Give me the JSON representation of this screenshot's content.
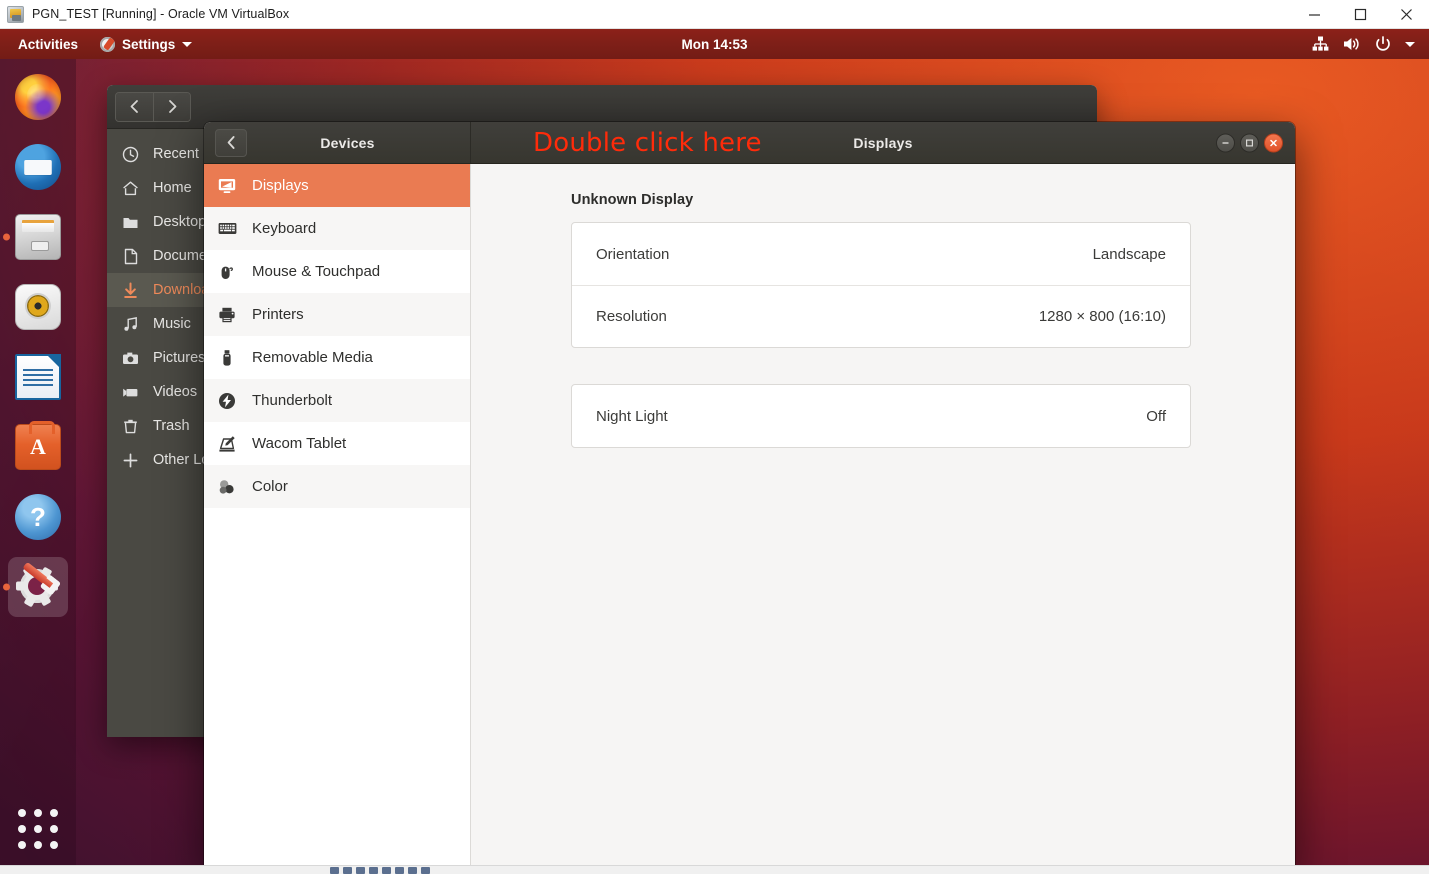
{
  "host": {
    "title": "PGN_TEST [Running] - Oracle VM VirtualBox",
    "icon": "virtualbox-icon",
    "window_controls": [
      {
        "name": "minimize",
        "glyph": "minimize-icon"
      },
      {
        "name": "maximize",
        "glyph": "maximize-icon"
      },
      {
        "name": "close",
        "glyph": "close-icon"
      }
    ]
  },
  "topbar": {
    "activities": "Activities",
    "app_menu": "Settings",
    "app_icon": "settings-app-icon",
    "clock": "Mon 14:53",
    "indicators": [
      {
        "name": "network-icon"
      },
      {
        "name": "volume-icon"
      },
      {
        "name": "power-icon"
      },
      {
        "name": "chevron-down-icon"
      }
    ]
  },
  "dock": {
    "items": [
      {
        "name": "firefox",
        "label": "Firefox",
        "icon": "firefox-icon",
        "active": false
      },
      {
        "name": "thunderbird",
        "label": "Thunderbird",
        "icon": "thunderbird-icon",
        "active": false
      },
      {
        "name": "files",
        "label": "Files",
        "icon": "files-icon",
        "active": true
      },
      {
        "name": "rhythmbox",
        "label": "Rhythmbox",
        "icon": "rhythmbox-icon",
        "active": false
      },
      {
        "name": "libreoffice",
        "label": "LibreOffice Writer",
        "icon": "libreoffice-icon",
        "active": false
      },
      {
        "name": "ubuntu-software",
        "label": "Ubuntu Software",
        "icon": "ubuntu-software-icon",
        "active": false
      },
      {
        "name": "help",
        "label": "Help",
        "icon": "help-icon",
        "active": false
      },
      {
        "name": "settings",
        "label": "Settings",
        "icon": "settings-icon",
        "active": true
      }
    ],
    "show_applications": "Show Applications"
  },
  "files_window": {
    "nav": {
      "back": "Back",
      "forward": "Forward"
    },
    "places": [
      {
        "label": "Recent",
        "icon": "clock-icon",
        "selected": false
      },
      {
        "label": "Home",
        "icon": "home-icon",
        "selected": false
      },
      {
        "label": "Desktop",
        "icon": "folder-icon",
        "selected": false
      },
      {
        "label": "Documents",
        "icon": "document-icon",
        "selected": false
      },
      {
        "label": "Downloads",
        "icon": "download-icon",
        "selected": true
      },
      {
        "label": "Music",
        "icon": "music-icon",
        "selected": false
      },
      {
        "label": "Pictures",
        "icon": "camera-icon",
        "selected": false
      },
      {
        "label": "Videos",
        "icon": "video-icon",
        "selected": false
      },
      {
        "label": "Trash",
        "icon": "trash-icon",
        "selected": false
      },
      {
        "label": "Other Locations",
        "icon": "plus-icon",
        "selected": false
      }
    ]
  },
  "settings_window": {
    "sidebar_title": "Devices",
    "back_button": "Back",
    "page_title": "Displays",
    "annotation": "Double click here",
    "window_controls": [
      {
        "name": "minimize",
        "glyph": "−"
      },
      {
        "name": "maximize",
        "glyph": "▣"
      },
      {
        "name": "close",
        "glyph": "×"
      }
    ],
    "sidebar_items": [
      {
        "label": "Displays",
        "icon": "display-icon",
        "selected": true
      },
      {
        "label": "Keyboard",
        "icon": "keyboard-icon",
        "selected": false
      },
      {
        "label": "Mouse & Touchpad",
        "icon": "mouse-icon",
        "selected": false
      },
      {
        "label": "Printers",
        "icon": "printer-icon",
        "selected": false
      },
      {
        "label": "Removable Media",
        "icon": "usb-icon",
        "selected": false
      },
      {
        "label": "Thunderbolt",
        "icon": "thunderbolt-icon",
        "selected": false
      },
      {
        "label": "Wacom Tablet",
        "icon": "wacom-tablet-icon",
        "selected": false
      },
      {
        "label": "Color",
        "icon": "color-icon",
        "selected": false
      }
    ],
    "display_section": {
      "heading": "Unknown Display",
      "rows": [
        {
          "label": "Orientation",
          "value": "Landscape"
        },
        {
          "label": "Resolution",
          "value": "1280 × 800 (16:10)"
        }
      ]
    },
    "night_light": {
      "rows": [
        {
          "label": "Night Light",
          "value": "Off"
        }
      ]
    }
  },
  "colors": {
    "accent_orange": "#ea7b52",
    "ubuntu_orange": "#e95420",
    "topbar": "#7e1f18",
    "header_dark": "#3a3934",
    "annotation_red": "#ff2b0a"
  }
}
